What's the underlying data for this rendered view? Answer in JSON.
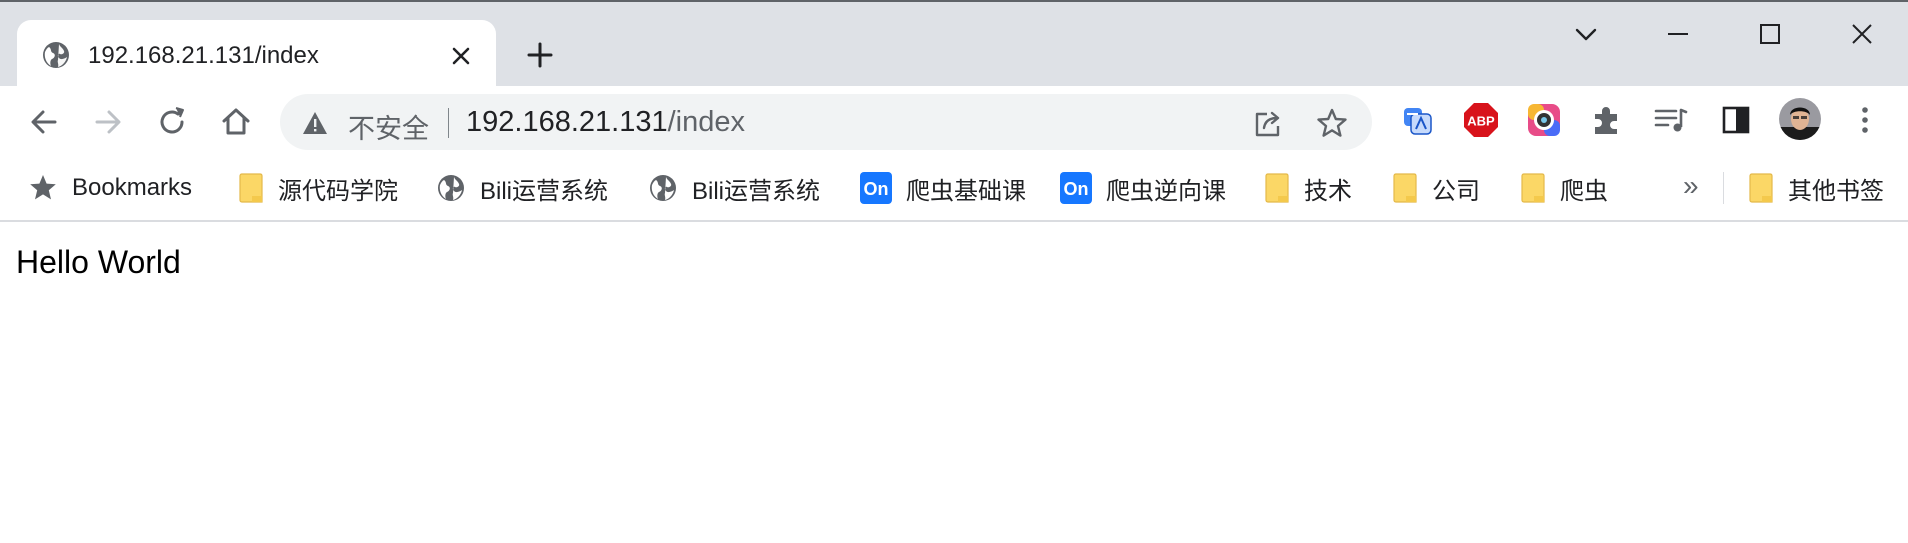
{
  "tab": {
    "title": "192.168.21.131/index"
  },
  "window_controls": [
    "search-tabs",
    "minimize",
    "maximize",
    "close"
  ],
  "omnibox": {
    "security_label": "不安全",
    "url_host": "192.168.21.131",
    "url_path": "/index"
  },
  "bookmarks": {
    "items": [
      {
        "label": "Bookmarks",
        "icon": "star-icon"
      },
      {
        "label": "源代码学院",
        "icon": "folder-icon"
      },
      {
        "label": "Bili运营系统",
        "icon": "globe-icon"
      },
      {
        "label": "Bili运营系统",
        "icon": "globe-icon"
      },
      {
        "label": "爬虫基础课",
        "icon": "on-icon"
      },
      {
        "label": "爬虫逆向课",
        "icon": "on-icon"
      },
      {
        "label": "技术",
        "icon": "folder-icon"
      },
      {
        "label": "公司",
        "icon": "folder-icon"
      },
      {
        "label": "爬虫",
        "icon": "folder-icon"
      }
    ],
    "overflow": "»",
    "other": {
      "label": "其他书签",
      "icon": "folder-icon"
    }
  },
  "extensions": {
    "abp_label": "ABP",
    "on_label": "On"
  },
  "page": {
    "text": "Hello World"
  },
  "colors": {
    "tabstrip_bg": "#dee1e6",
    "omnibox_bg": "#f1f3f4",
    "abp_red": "#d8131b",
    "on_blue": "#1677ff",
    "folder_yellow": "#fbd766"
  }
}
